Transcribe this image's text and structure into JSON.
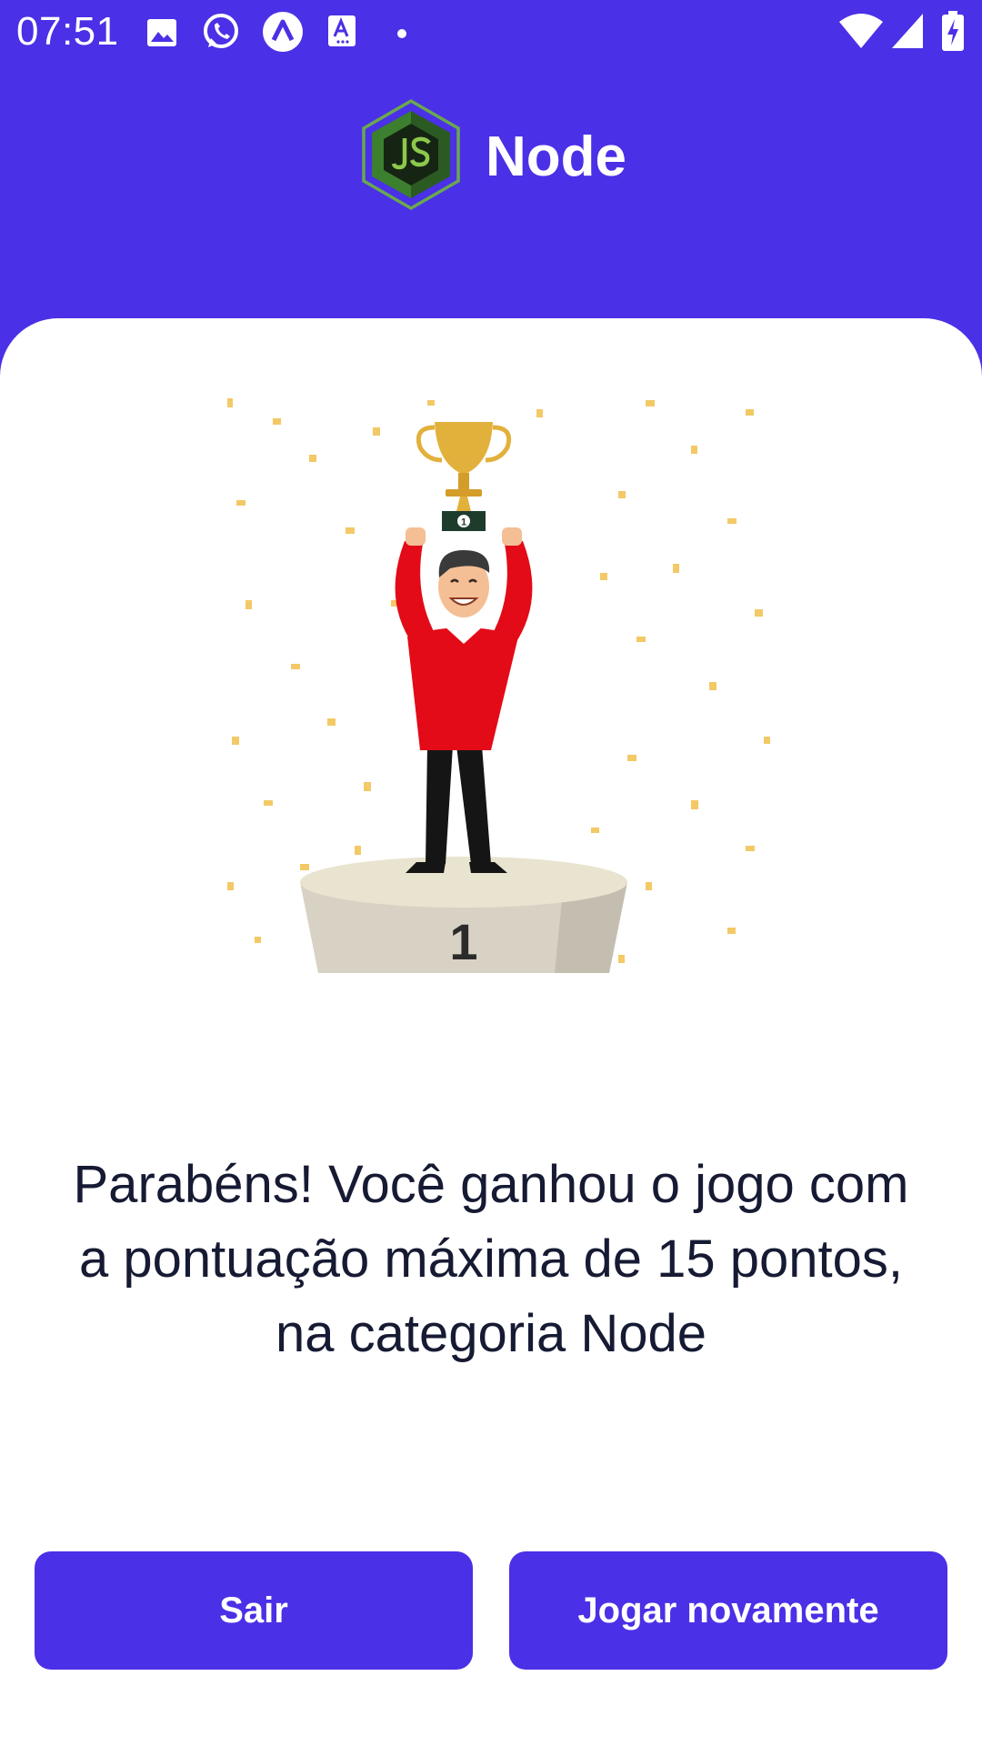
{
  "status_bar": {
    "time": "07:51",
    "left_icons": [
      "gallery-icon",
      "whatsapp-icon",
      "app-icon",
      "font-icon",
      "dot-icon"
    ],
    "right_icons": [
      "wifi-icon",
      "signal-icon",
      "battery-charging-icon"
    ]
  },
  "header": {
    "logo_icon": "nodejs-logo-icon",
    "title": "Node"
  },
  "illustration": {
    "podium_number": "1",
    "medal_number": "1"
  },
  "result": {
    "message": "Parabéns! Você ganhou o jogo com a pontuação máxima de 15 pontos, na categoria Node"
  },
  "actions": {
    "exit_label": "Sair",
    "replay_label": "Jogar novamente"
  },
  "colors": {
    "primary": "#4a30e6",
    "text": "#161a33",
    "confetti": "#f2c04c",
    "shirt": "#e30b17",
    "trophy": "#e2b13c"
  }
}
